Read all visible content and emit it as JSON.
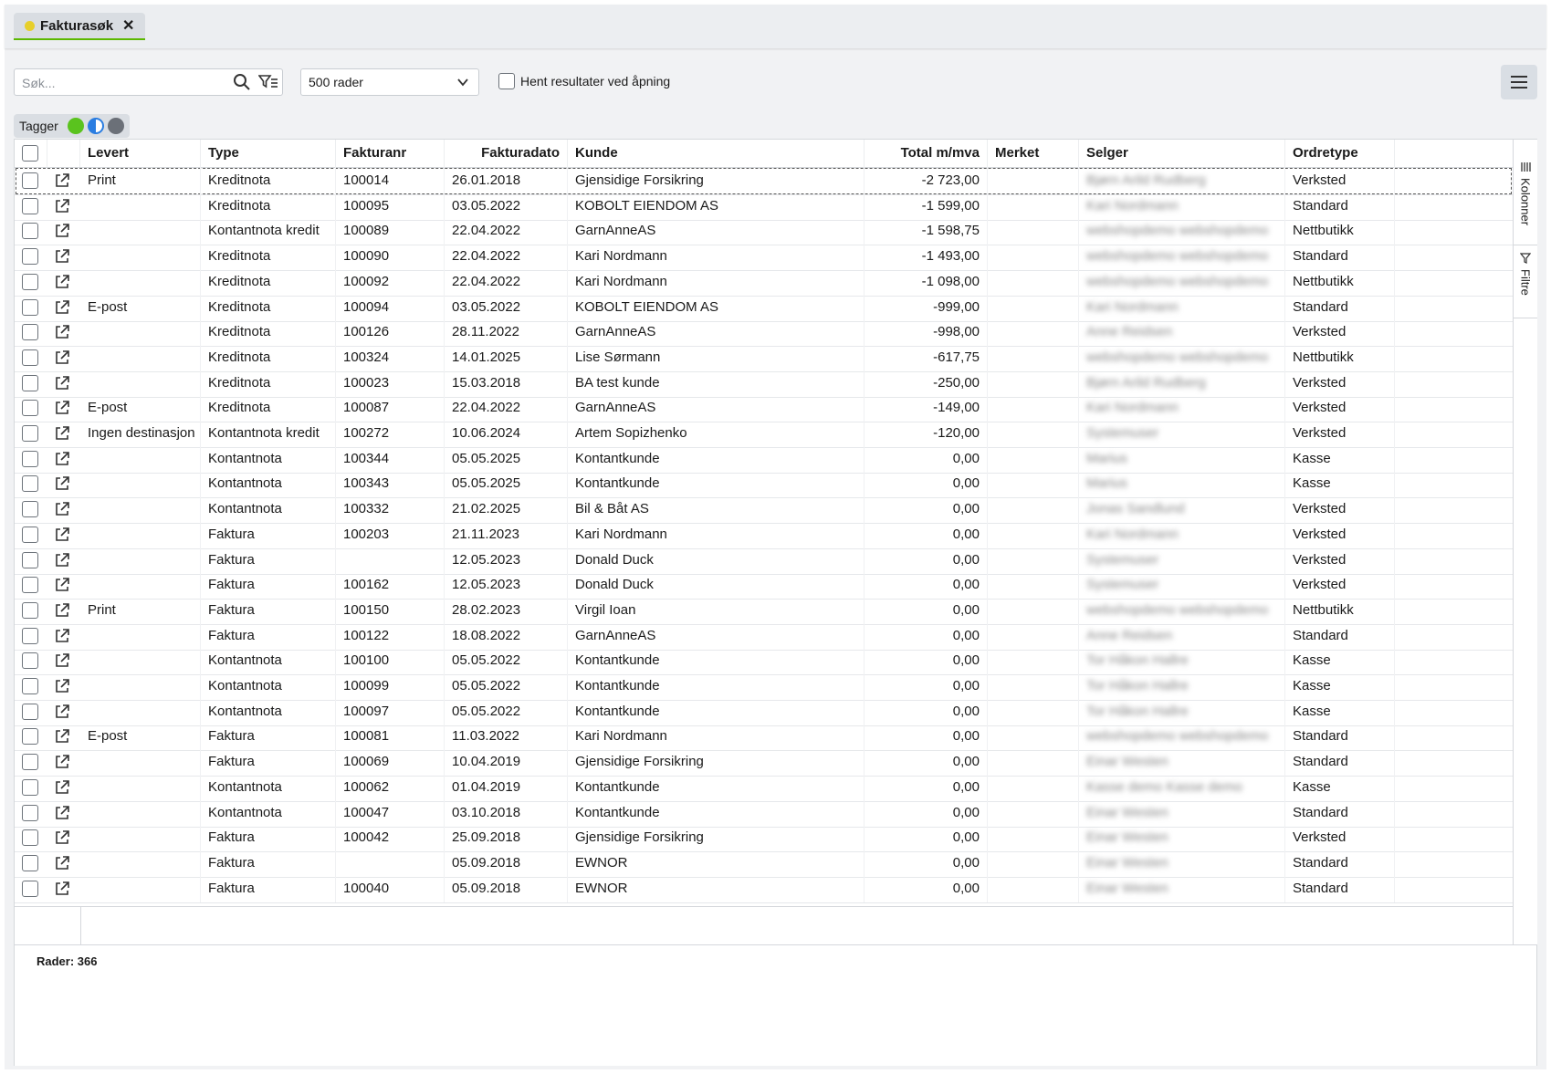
{
  "tab": {
    "title": "Fakturasøk",
    "close": "✕"
  },
  "search": {
    "placeholder": "Søk..."
  },
  "rows_select": {
    "value": "500 rader"
  },
  "fetch_on_open": {
    "label": "Hent resultater ved åpning"
  },
  "tags": {
    "label": "Tagger",
    "colors": [
      "#5ac31e",
      "#2a7de1",
      "#6b7078"
    ]
  },
  "columns": [
    "Levert",
    "Type",
    "Fakturanr",
    "Fakturadato",
    "Kunde",
    "Total m/mva",
    "Merket",
    "Selger",
    "Ordretype"
  ],
  "rows": [
    {
      "levert": "Print",
      "type": "Kreditnota",
      "nr": "100014",
      "dato": "26.01.2018",
      "kunde": "Gjensidige Forsikring",
      "total": "-2 723,00",
      "selger": "Bjørn Arild Rudberg",
      "ordretype": "Verksted"
    },
    {
      "levert": "",
      "type": "Kreditnota",
      "nr": "100095",
      "dato": "03.05.2022",
      "kunde": "KOBOLT EIENDOM AS",
      "total": "-1 599,00",
      "selger": "Kari Nordmann",
      "ordretype": "Standard"
    },
    {
      "levert": "",
      "type": "Kontantnota kredit",
      "nr": "100089",
      "dato": "22.04.2022",
      "kunde": "GarnAnneAS",
      "total": "-1 598,75",
      "selger": "webshopdemo webshopdemo",
      "ordretype": "Nettbutikk"
    },
    {
      "levert": "",
      "type": "Kreditnota",
      "nr": "100090",
      "dato": "22.04.2022",
      "kunde": "Kari Nordmann",
      "total": "-1 493,00",
      "selger": "webshopdemo webshopdemo",
      "ordretype": "Standard"
    },
    {
      "levert": "",
      "type": "Kreditnota",
      "nr": "100092",
      "dato": "22.04.2022",
      "kunde": "Kari Nordmann",
      "total": "-1 098,00",
      "selger": "webshopdemo webshopdemo",
      "ordretype": "Nettbutikk"
    },
    {
      "levert": "E-post",
      "type": "Kreditnota",
      "nr": "100094",
      "dato": "03.05.2022",
      "kunde": "KOBOLT EIENDOM AS",
      "total": "-999,00",
      "selger": "Kari Nordmann",
      "ordretype": "Standard"
    },
    {
      "levert": "",
      "type": "Kreditnota",
      "nr": "100126",
      "dato": "28.11.2022",
      "kunde": "GarnAnneAS",
      "total": "-998,00",
      "selger": "Anne Reidsen",
      "ordretype": "Verksted"
    },
    {
      "levert": "",
      "type": "Kreditnota",
      "nr": "100324",
      "dato": "14.01.2025",
      "kunde": "Lise Sørmann",
      "total": "-617,75",
      "selger": "webshopdemo webshopdemo",
      "ordretype": "Nettbutikk"
    },
    {
      "levert": "",
      "type": "Kreditnota",
      "nr": "100023",
      "dato": "15.03.2018",
      "kunde": "BA test kunde",
      "total": "-250,00",
      "selger": "Bjørn Arild Rudberg",
      "ordretype": "Verksted"
    },
    {
      "levert": "E-post",
      "type": "Kreditnota",
      "nr": "100087",
      "dato": "22.04.2022",
      "kunde": "GarnAnneAS",
      "total": "-149,00",
      "selger": "Kari Nordmann",
      "ordretype": "Verksted"
    },
    {
      "levert": "Ingen destinasjon",
      "type": "Kontantnota kredit",
      "nr": "100272",
      "dato": "10.06.2024",
      "kunde": "Artem Sopizhenko",
      "total": "-120,00",
      "selger": "Systemuser",
      "ordretype": "Verksted"
    },
    {
      "levert": "",
      "type": "Kontantnota",
      "nr": "100344",
      "dato": "05.05.2025",
      "kunde": "Kontantkunde",
      "total": "0,00",
      "selger": "Marius",
      "ordretype": "Kasse"
    },
    {
      "levert": "",
      "type": "Kontantnota",
      "nr": "100343",
      "dato": "05.05.2025",
      "kunde": "Kontantkunde",
      "total": "0,00",
      "selger": "Marius",
      "ordretype": "Kasse"
    },
    {
      "levert": "",
      "type": "Kontantnota",
      "nr": "100332",
      "dato": "21.02.2025",
      "kunde": "Bil & Båt AS",
      "total": "0,00",
      "selger": "Jonas Sandlund",
      "ordretype": "Verksted"
    },
    {
      "levert": "",
      "type": "Faktura",
      "nr": "100203",
      "dato": "21.11.2023",
      "kunde": "Kari Nordmann",
      "total": "0,00",
      "selger": "Kari Nordmann",
      "ordretype": "Verksted"
    },
    {
      "levert": "",
      "type": "Faktura",
      "nr": "",
      "dato": "12.05.2023",
      "kunde": "Donald Duck",
      "total": "0,00",
      "selger": "Systemuser",
      "ordretype": "Verksted"
    },
    {
      "levert": "",
      "type": "Faktura",
      "nr": "100162",
      "dato": "12.05.2023",
      "kunde": "Donald Duck",
      "total": "0,00",
      "selger": "Systemuser",
      "ordretype": "Verksted"
    },
    {
      "levert": "Print",
      "type": "Faktura",
      "nr": "100150",
      "dato": "28.02.2023",
      "kunde": "Virgil Ioan",
      "total": "0,00",
      "selger": "webshopdemo webshopdemo",
      "ordretype": "Nettbutikk"
    },
    {
      "levert": "",
      "type": "Faktura",
      "nr": "100122",
      "dato": "18.08.2022",
      "kunde": "GarnAnneAS",
      "total": "0,00",
      "selger": "Anne Reidsen",
      "ordretype": "Standard"
    },
    {
      "levert": "",
      "type": "Kontantnota",
      "nr": "100100",
      "dato": "05.05.2022",
      "kunde": "Kontantkunde",
      "total": "0,00",
      "selger": "Tor Håkon Hallre",
      "ordretype": "Kasse"
    },
    {
      "levert": "",
      "type": "Kontantnota",
      "nr": "100099",
      "dato": "05.05.2022",
      "kunde": "Kontantkunde",
      "total": "0,00",
      "selger": "Tor Håkon Hallre",
      "ordretype": "Kasse"
    },
    {
      "levert": "",
      "type": "Kontantnota",
      "nr": "100097",
      "dato": "05.05.2022",
      "kunde": "Kontantkunde",
      "total": "0,00",
      "selger": "Tor Håkon Hallre",
      "ordretype": "Kasse"
    },
    {
      "levert": "E-post",
      "type": "Faktura",
      "nr": "100081",
      "dato": "11.03.2022",
      "kunde": "Kari Nordmann",
      "total": "0,00",
      "selger": "webshopdemo webshopdemo",
      "ordretype": "Standard"
    },
    {
      "levert": "",
      "type": "Faktura",
      "nr": "100069",
      "dato": "10.04.2019",
      "kunde": "Gjensidige Forsikring",
      "total": "0,00",
      "selger": "Einar Westen",
      "ordretype": "Standard"
    },
    {
      "levert": "",
      "type": "Kontantnota",
      "nr": "100062",
      "dato": "01.04.2019",
      "kunde": "Kontantkunde",
      "total": "0,00",
      "selger": "Kasse demo Kasse demo",
      "ordretype": "Kasse"
    },
    {
      "levert": "",
      "type": "Kontantnota",
      "nr": "100047",
      "dato": "03.10.2018",
      "kunde": "Kontantkunde",
      "total": "0,00",
      "selger": "Einar Westen",
      "ordretype": "Standard"
    },
    {
      "levert": "",
      "type": "Faktura",
      "nr": "100042",
      "dato": "25.09.2018",
      "kunde": "Gjensidige Forsikring",
      "total": "0,00",
      "selger": "Einar Westen",
      "ordretype": "Verksted"
    },
    {
      "levert": "",
      "type": "Faktura",
      "nr": "",
      "dato": "05.09.2018",
      "kunde": "EWNOR",
      "total": "0,00",
      "selger": "Einar Westen",
      "ordretype": "Standard"
    },
    {
      "levert": "",
      "type": "Faktura",
      "nr": "100040",
      "dato": "05.09.2018",
      "kunde": "EWNOR",
      "total": "0,00",
      "selger": "Einar Westen",
      "ordretype": "Standard"
    }
  ],
  "side": {
    "columns_label": "Kolonner",
    "filters_label": "Filtre"
  },
  "footer": {
    "count_label": "Rader: 366"
  }
}
